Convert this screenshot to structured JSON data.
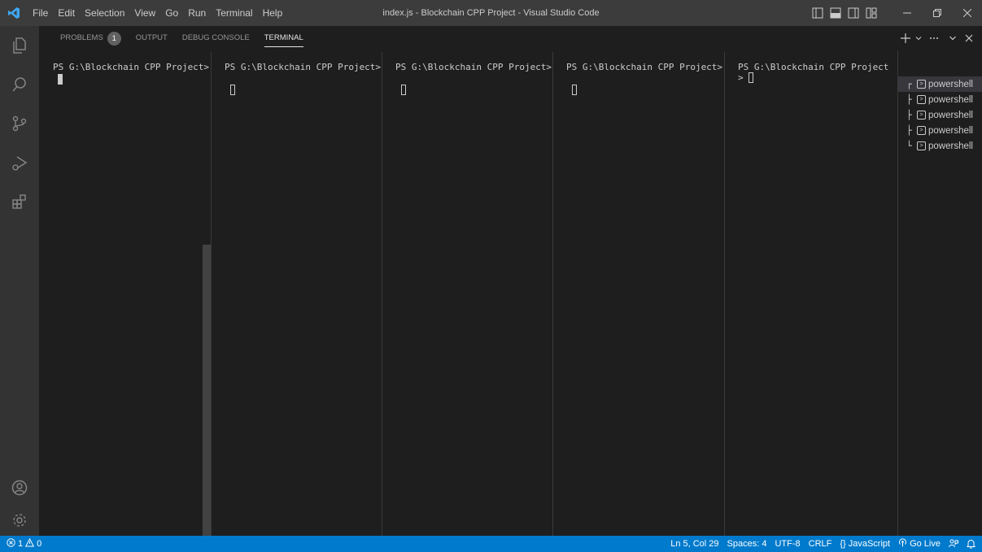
{
  "menubar": {
    "items": [
      "File",
      "Edit",
      "Selection",
      "View",
      "Go",
      "Run",
      "Terminal",
      "Help"
    ]
  },
  "window": {
    "title": "index.js - Blockchain CPP Project - Visual Studio Code"
  },
  "panel": {
    "tabs": [
      {
        "label": "PROBLEMS",
        "badge": "1"
      },
      {
        "label": "OUTPUT"
      },
      {
        "label": "DEBUG CONSOLE"
      },
      {
        "label": "TERMINAL",
        "active": true
      }
    ]
  },
  "terminals": {
    "prompts": [
      "PS G:\\Blockchain CPP Project>",
      "PS G:\\Blockchain CPP Project>",
      "PS G:\\Blockchain CPP Project>",
      "PS G:\\Blockchain CPP Project>",
      "PS G:\\Blockchain CPP Project"
    ],
    "wrap_continuation": ">"
  },
  "terminal_list": {
    "items": [
      "powershell",
      "powershell",
      "powershell",
      "powershell",
      "powershell"
    ]
  },
  "statusbar": {
    "errors": "1",
    "warnings": "0",
    "position": "Ln 5, Col 29",
    "spaces": "Spaces: 4",
    "encoding": "UTF-8",
    "eol": "CRLF",
    "language": "JavaScript",
    "golive": "Go Live"
  },
  "colors": {
    "accent": "#007acc",
    "titlebar": "#3c3c3c",
    "activitybar": "#333333",
    "background": "#1e1e1e"
  }
}
